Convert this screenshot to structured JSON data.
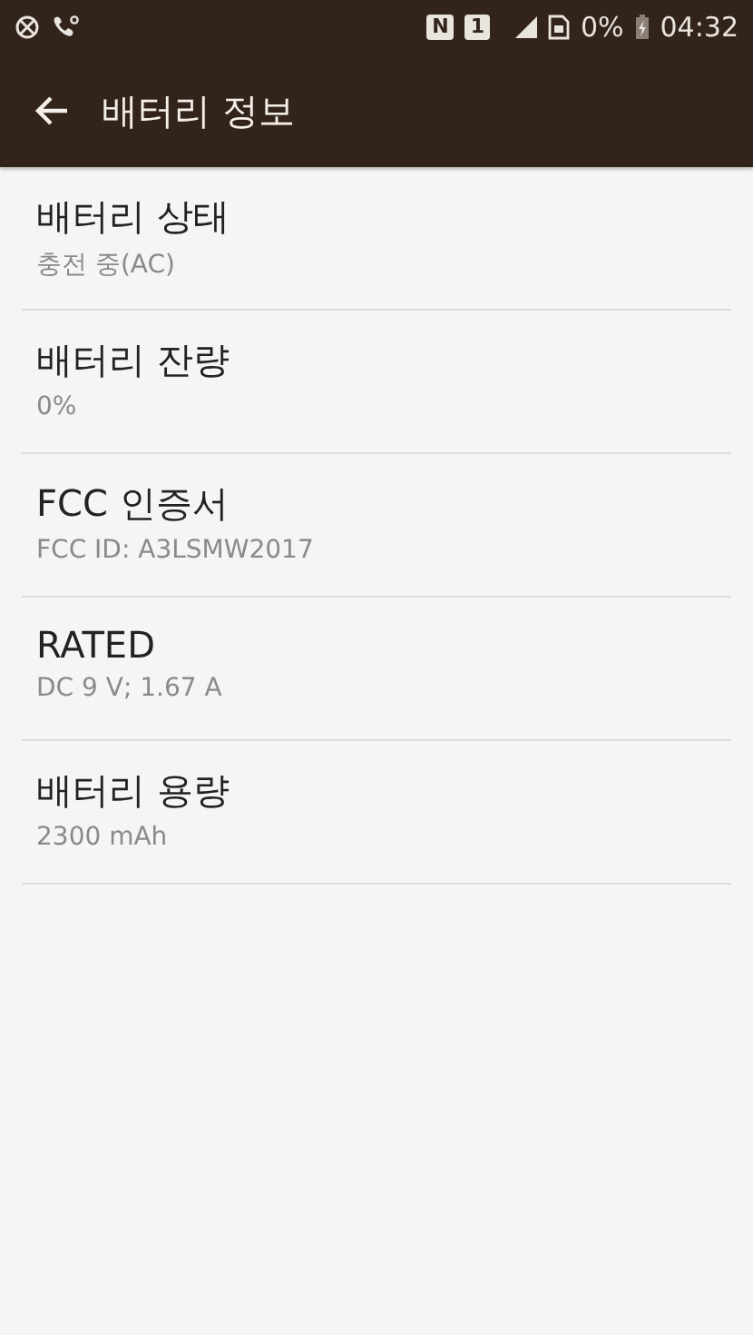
{
  "status_bar": {
    "badges": [
      "N",
      "1"
    ],
    "battery_percent": "0%",
    "time": "04:32"
  },
  "toolbar": {
    "title": "배터리 정보"
  },
  "items": [
    {
      "title": "배터리 상태",
      "summary": "충전 중(AC)"
    },
    {
      "title": "배터리 잔량",
      "summary": "0%"
    },
    {
      "title": "FCC 인증서",
      "summary": "FCC ID: A3LSMW2017"
    },
    {
      "title": "RATED",
      "summary": "DC 9 V; 1.67 A"
    },
    {
      "title": "배터리 용량",
      "summary": "2300 mAh"
    }
  ]
}
